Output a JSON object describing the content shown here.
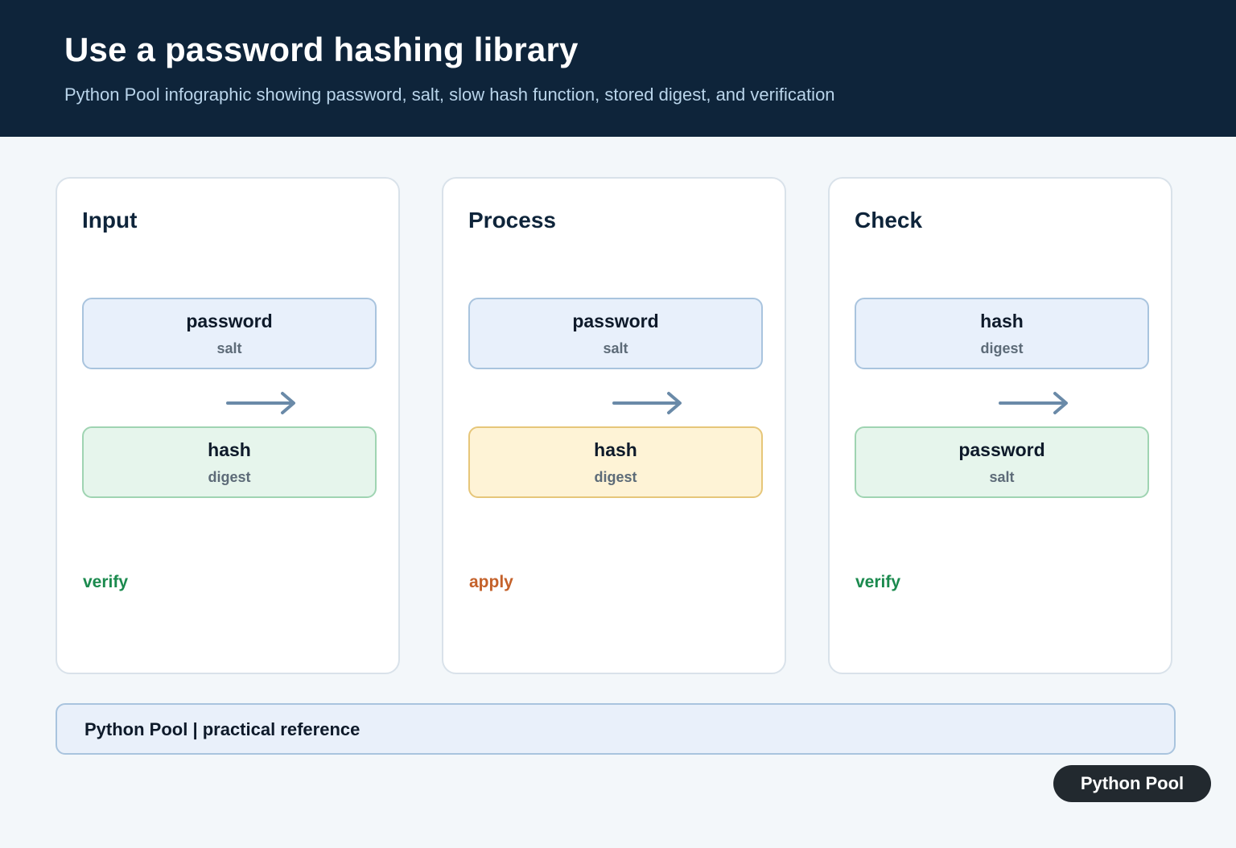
{
  "header": {
    "title": "Use a password hashing library",
    "subtitle": "Python Pool infographic showing password, salt, slow hash function, stored digest, and verification"
  },
  "colors": {
    "header_bg": "#0e243a",
    "arrow": "#6a8aa8",
    "verify": "#1b8a4e",
    "apply": "#c4612a"
  },
  "cards": [
    {
      "title": "Input",
      "top_box": {
        "main": "password",
        "sub": "salt"
      },
      "bottom_box": {
        "main": "hash",
        "sub": "digest"
      },
      "action": "verify"
    },
    {
      "title": "Process",
      "top_box": {
        "main": "password",
        "sub": "salt"
      },
      "bottom_box": {
        "main": "hash",
        "sub": "digest"
      },
      "action": "apply"
    },
    {
      "title": "Check",
      "top_box": {
        "main": "hash",
        "sub": "digest"
      },
      "bottom_box": {
        "main": "password",
        "sub": "salt"
      },
      "action": "verify"
    }
  ],
  "footer": {
    "text": "Python Pool | practical reference",
    "badge": "Python Pool"
  }
}
